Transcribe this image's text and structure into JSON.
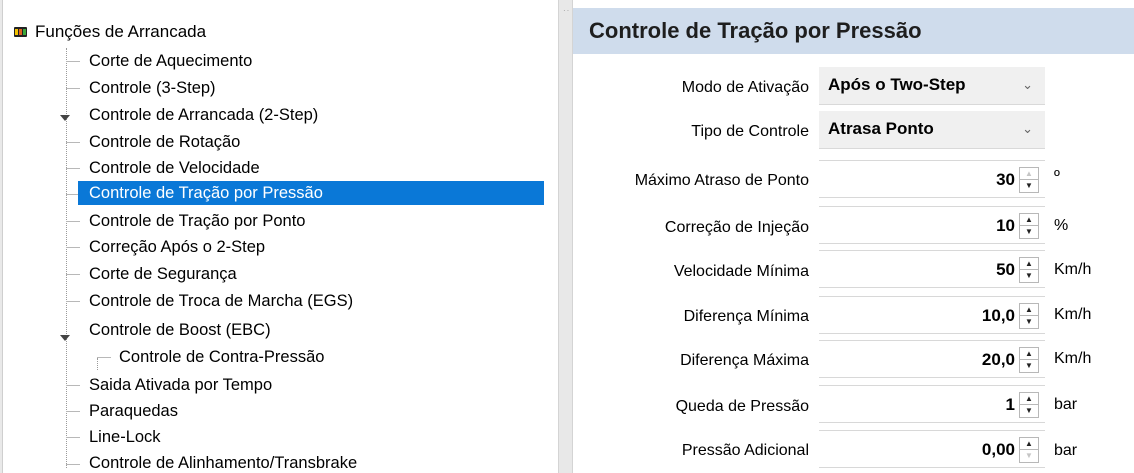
{
  "tree": {
    "root_label": "Funções de Arrancada",
    "items": [
      {
        "label": "Corte de Aquecimento"
      },
      {
        "label": "Controle (3-Step)"
      },
      {
        "label": "Controle de Arrancada (2-Step)"
      },
      {
        "label": "Controle de Rotação"
      },
      {
        "label": "Controle de Velocidade"
      },
      {
        "label": "Controle de Tração por Pressão"
      },
      {
        "label": "Controle de Tração por Ponto"
      },
      {
        "label": "Correção Após o 2-Step"
      },
      {
        "label": "Corte de Segurança"
      },
      {
        "label": "Controle de Troca de Marcha (EGS)"
      },
      {
        "label": "Controle de Boost (EBC)"
      },
      {
        "label": "Controle de Contra-Pressão"
      },
      {
        "label": "Saida Ativada por Tempo"
      },
      {
        "label": "Paraquedas"
      },
      {
        "label": "Line-Lock"
      },
      {
        "label": "Controle de Alinhamento/Transbrake"
      }
    ]
  },
  "form": {
    "title": "Controle de Tração por Pressão",
    "fields": [
      {
        "label": "Modo de Ativação",
        "value": "Após o Two-Step",
        "unit": ""
      },
      {
        "label": "Tipo de Controle",
        "value": "Atrasa Ponto",
        "unit": ""
      },
      {
        "label": "Máximo Atraso de Ponto",
        "value": "30",
        "unit": "º"
      },
      {
        "label": "Correção de Injeção",
        "value": "10",
        "unit": "%"
      },
      {
        "label": "Velocidade Mínima",
        "value": "50",
        "unit": "Km/h"
      },
      {
        "label": "Diferença Mínima",
        "value": "10,0",
        "unit": "Km/h"
      },
      {
        "label": "Diferença Máxima",
        "value": "20,0",
        "unit": "Km/h"
      },
      {
        "label": "Queda de Pressão",
        "value": "1",
        "unit": "bar"
      },
      {
        "label": "Pressão Adicional",
        "value": "0,00",
        "unit": "bar"
      }
    ]
  },
  "colors": {
    "selection": "#0a78d7",
    "header_bg": "#cfdcec"
  },
  "icons": {
    "root": "traffic-light-icon",
    "expander": "chevron-down-icon",
    "dropdown": "chevron-down-icon",
    "spinner": "spin-up-down-icon"
  }
}
